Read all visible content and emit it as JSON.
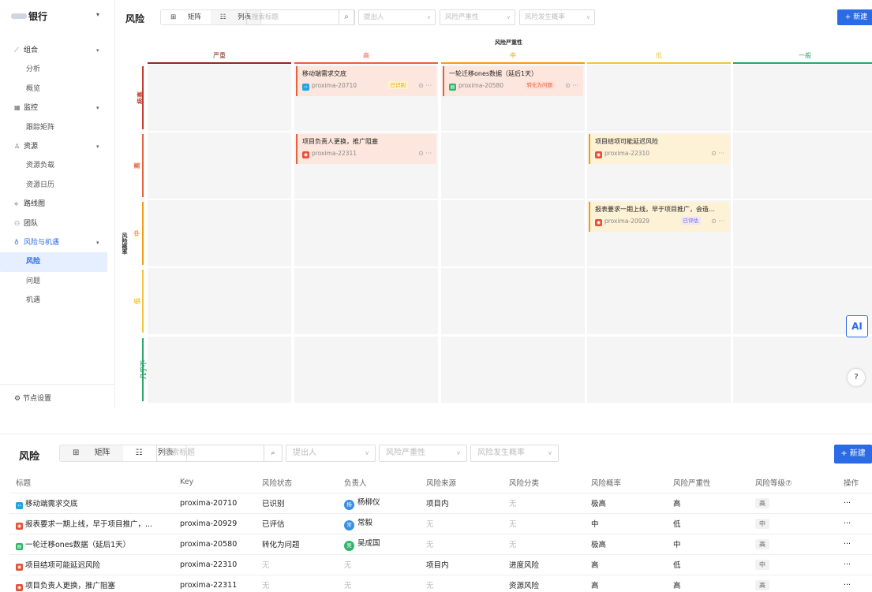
{
  "sidebar": {
    "bank_name": "银行",
    "items": [
      {
        "icon": "chart-line-icon",
        "label": "组合",
        "type": "group"
      },
      {
        "label": "分析",
        "type": "sub"
      },
      {
        "label": "概览",
        "type": "sub"
      },
      {
        "icon": "grid-icon",
        "label": "监控",
        "type": "group"
      },
      {
        "label": "跟踪矩阵",
        "type": "sub"
      },
      {
        "icon": "user-icon",
        "label": "资源",
        "type": "group"
      },
      {
        "label": "资源负载",
        "type": "sub"
      },
      {
        "label": "资源日历",
        "type": "sub"
      },
      {
        "icon": "route-icon",
        "label": "路线图",
        "type": "plain"
      },
      {
        "icon": "team-icon",
        "label": "团队",
        "type": "plain"
      },
      {
        "icon": "bulb-icon",
        "label": "风险与机遇",
        "type": "group-active"
      },
      {
        "label": "风险",
        "type": "active"
      },
      {
        "label": "问题",
        "type": "sub"
      },
      {
        "label": "机遇",
        "type": "sub"
      }
    ],
    "node_settings": "节点设置"
  },
  "toolbar": {
    "title": "风险",
    "view_matrix": "矩阵",
    "view_list": "列表",
    "search_placeholder": "搜索标题",
    "filter_reporter": "提出人",
    "filter_severity": "风险严重性",
    "filter_probability": "风险发生概率",
    "new_button": "+ 新建"
  },
  "matrix": {
    "severity_title": "风险严重性",
    "probability_title": "风险概率",
    "columns": [
      {
        "label": "严重",
        "color": "#8b2a1e"
      },
      {
        "label": "高",
        "color": "#e8613c"
      },
      {
        "label": "中",
        "color": "#f39c12"
      },
      {
        "label": "低",
        "color": "#f4c33d"
      },
      {
        "label": "一般",
        "color": "#2fa36b"
      }
    ],
    "rows": [
      {
        "label": "极高",
        "color": "#c0392b"
      },
      {
        "label": "高",
        "color": "#e8613c"
      },
      {
        "label": "中",
        "color": "#f39c12"
      },
      {
        "label": "低",
        "color": "#f4c33d"
      },
      {
        "label": "几乎不",
        "color": "#2fa36b"
      }
    ],
    "cards": [
      {
        "row": 0,
        "col": 1,
        "title": "移动端需求交底",
        "key": "proxima-20710",
        "icon": "blue",
        "tag": "已识别",
        "tag_color": "#e8a400",
        "tag_bg": "#fff3cc",
        "bg": "#fde6dd",
        "border": "#e8613c"
      },
      {
        "row": 0,
        "col": 2,
        "title": "一轮迁移ones数据（延后1天）",
        "key": "proxima-20580",
        "icon": "green",
        "tag": "转化为问题",
        "tag_color": "#e8613c",
        "tag_bg": "#fde0d6",
        "bg": "#fde6dd",
        "border": "#e8613c"
      },
      {
        "row": 1,
        "col": 1,
        "title": "项目负责人更换，推广阻塞",
        "key": "proxima-22311",
        "icon": "red",
        "tag": "",
        "tag_color": "",
        "tag_bg": "",
        "bg": "#fde6dd",
        "border": "#e8613c"
      },
      {
        "row": 1,
        "col": 3,
        "title": "项目结项可能延迟风险",
        "key": "proxima-22310",
        "icon": "red",
        "tag": "",
        "tag_color": "",
        "tag_bg": "",
        "bg": "#fdf1d6",
        "border": "#f39c12"
      },
      {
        "row": 2,
        "col": 3,
        "title": "报表要求一期上线，早于项目推广，会造…",
        "key": "proxima-20929",
        "icon": "red",
        "tag": "已评估",
        "tag_color": "#7b5fd6",
        "tag_bg": "#ece6fb",
        "bg": "#fdf1d6",
        "border": "#f39c12"
      }
    ]
  },
  "ai_label": "AI",
  "help_label": "?",
  "list_view": {
    "title": "风险",
    "view_matrix": "矩阵",
    "view_list": "列表",
    "search_placeholder": "搜索标题",
    "filter_reporter": "提出人",
    "filter_severity": "风险严重性",
    "filter_probability": "风险发生概率",
    "new_button": "+ 新建",
    "columns": [
      "标题",
      "Key",
      "风险状态",
      "负责人",
      "风险来源",
      "风险分类",
      "风险概率",
      "风险严重性",
      "风险等级⑦",
      "操作"
    ],
    "rows": [
      {
        "icon": "blue",
        "title": "移动端需求交底",
        "key": "proxima-20710",
        "status": "已识别",
        "avatar_char": "杨",
        "avatar_color": "#3a8ee6",
        "owner": "杨柳仪",
        "source": "项目内",
        "category": "无",
        "probability": "极高",
        "severity": "高",
        "level": "高",
        "actions": "···"
      },
      {
        "icon": "red",
        "title": "报表要求一期上线，早于项目推广，...",
        "key": "proxima-20929",
        "status": "已评估",
        "avatar_char": "常",
        "avatar_color": "#3a8ee6",
        "owner": "常毅",
        "source": "无",
        "category": "无",
        "probability": "中",
        "severity": "低",
        "level": "中",
        "actions": "···"
      },
      {
        "icon": "green",
        "title": "一轮迁移ones数据（延后1天）",
        "key": "proxima-20580",
        "status": "转化为问题",
        "avatar_char": "吴",
        "avatar_color": "#2fb56a",
        "owner": "吴成国",
        "source": "无",
        "category": "无",
        "probability": "极高",
        "severity": "中",
        "level": "高",
        "actions": "···"
      },
      {
        "icon": "red",
        "title": "项目结项可能延迟风险",
        "key": "proxima-22310",
        "status": "无",
        "avatar_char": "",
        "avatar_color": "",
        "owner": "无",
        "source": "项目内",
        "category": "进度风险",
        "probability": "高",
        "severity": "低",
        "level": "中",
        "actions": "···"
      },
      {
        "icon": "red",
        "title": "项目负责人更换，推广阻塞",
        "key": "proxima-22311",
        "status": "无",
        "avatar_char": "",
        "avatar_color": "",
        "owner": "无",
        "source": "无",
        "category": "资源风险",
        "probability": "高",
        "severity": "高",
        "level": "高",
        "actions": "···"
      }
    ]
  }
}
